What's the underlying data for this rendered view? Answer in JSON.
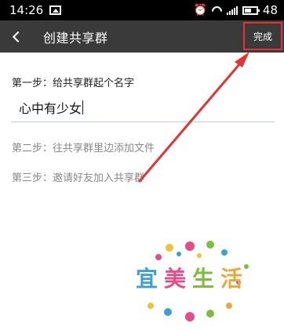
{
  "status_bar": {
    "time": "14:26",
    "battery": "48",
    "icons": [
      "image-icon",
      "alarm-icon",
      "wifi-icon",
      "signal-icon",
      "battery-icon"
    ]
  },
  "title_bar": {
    "title": "创建共享群",
    "done_label": "完成",
    "highlight_color": "#e63232"
  },
  "form": {
    "step1": "第一步：给共享群起个名字",
    "group_name_value": "心中有少女",
    "step2": "第二步：往共享群里边添加文件",
    "step3": "第三步：邀请好友加入共享群"
  },
  "watermark": {
    "chars": [
      "宜",
      "美",
      "生",
      "活"
    ],
    "colors": [
      "#3aa0d8",
      "#e84a8a",
      "#7bbf3a",
      "#e8a93a"
    ]
  }
}
